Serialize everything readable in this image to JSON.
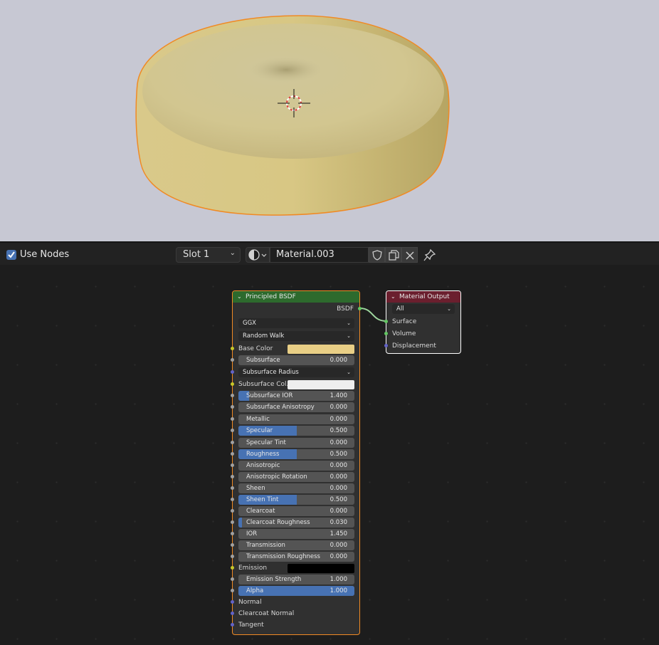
{
  "header": {
    "use_nodes_label": "Use Nodes",
    "use_nodes_checked": true,
    "slot_label": "Slot 1",
    "material_name": "Material.003"
  },
  "colors": {
    "accent": "#4772b3",
    "base_color": "#e9cf86",
    "subsurface_color": "#eeeeee",
    "emission_color": "#000000",
    "selection_outline": "#f08a24",
    "shader_header": "#2d6a2d",
    "output_header": "#6b1f2e"
  },
  "bsdf_node": {
    "title": "Principled BSDF",
    "output_label": "BSDF",
    "distribution": "GGX",
    "subsurface_method": "Random Walk",
    "inputs": [
      {
        "kind": "color",
        "label": "Base Color",
        "color": "#e9cf86",
        "socket": "#c7c729"
      },
      {
        "kind": "value",
        "label": "Subsurface",
        "value": "0.000",
        "fraction": 0,
        "socket": "#a1a1a1"
      },
      {
        "kind": "drop",
        "label": "Subsurface Radius",
        "socket": "#6363c7"
      },
      {
        "kind": "color",
        "label": "Subsurface Col...",
        "color": "#eeeeee",
        "socket": "#c7c729"
      },
      {
        "kind": "value",
        "label": "Subsurface IOR",
        "value": "1.400",
        "fraction": 0.09,
        "socket": "#a1a1a1"
      },
      {
        "kind": "value",
        "label": "Subsurface Anisotropy",
        "value": "0.000",
        "fraction": 0,
        "socket": "#a1a1a1"
      },
      {
        "kind": "value",
        "label": "Metallic",
        "value": "0.000",
        "fraction": 0,
        "socket": "#a1a1a1"
      },
      {
        "kind": "value",
        "label": "Specular",
        "value": "0.500",
        "fraction": 0.5,
        "socket": "#a1a1a1"
      },
      {
        "kind": "value",
        "label": "Specular Tint",
        "value": "0.000",
        "fraction": 0,
        "socket": "#a1a1a1"
      },
      {
        "kind": "value",
        "label": "Roughness",
        "value": "0.500",
        "fraction": 0.5,
        "socket": "#a1a1a1"
      },
      {
        "kind": "value",
        "label": "Anisotropic",
        "value": "0.000",
        "fraction": 0,
        "socket": "#a1a1a1"
      },
      {
        "kind": "value",
        "label": "Anisotropic Rotation",
        "value": "0.000",
        "fraction": 0,
        "socket": "#a1a1a1"
      },
      {
        "kind": "value",
        "label": "Sheen",
        "value": "0.000",
        "fraction": 0,
        "socket": "#a1a1a1"
      },
      {
        "kind": "value",
        "label": "Sheen Tint",
        "value": "0.500",
        "fraction": 0.5,
        "socket": "#a1a1a1"
      },
      {
        "kind": "value",
        "label": "Clearcoat",
        "value": "0.000",
        "fraction": 0,
        "socket": "#a1a1a1"
      },
      {
        "kind": "value",
        "label": "Clearcoat Roughness",
        "value": "0.030",
        "fraction": 0.03,
        "socket": "#a1a1a1"
      },
      {
        "kind": "value",
        "label": "IOR",
        "value": "1.450",
        "fraction": 0,
        "socket": "#a1a1a1"
      },
      {
        "kind": "value",
        "label": "Transmission",
        "value": "0.000",
        "fraction": 0,
        "socket": "#a1a1a1"
      },
      {
        "kind": "value",
        "label": "Transmission Roughness",
        "value": "0.000",
        "fraction": 0,
        "socket": "#a1a1a1"
      },
      {
        "kind": "color",
        "label": "Emission",
        "color": "#000000",
        "socket": "#c7c729"
      },
      {
        "kind": "value",
        "label": "Emission Strength",
        "value": "1.000",
        "fraction": 0,
        "socket": "#a1a1a1"
      },
      {
        "kind": "value",
        "label": "Alpha",
        "value": "1.000",
        "fraction": 1,
        "socket": "#a1a1a1"
      },
      {
        "kind": "plain",
        "label": "Normal",
        "socket": "#6363c7"
      },
      {
        "kind": "plain",
        "label": "Clearcoat Normal",
        "socket": "#6363c7"
      },
      {
        "kind": "plain",
        "label": "Tangent",
        "socket": "#6363c7"
      }
    ]
  },
  "output_node": {
    "title": "Material Output",
    "target": "All",
    "inputs": [
      {
        "label": "Surface",
        "socket": "#63c763"
      },
      {
        "label": "Volume",
        "socket": "#63c763"
      },
      {
        "label": "Displacement",
        "socket": "#6363c7"
      }
    ]
  }
}
